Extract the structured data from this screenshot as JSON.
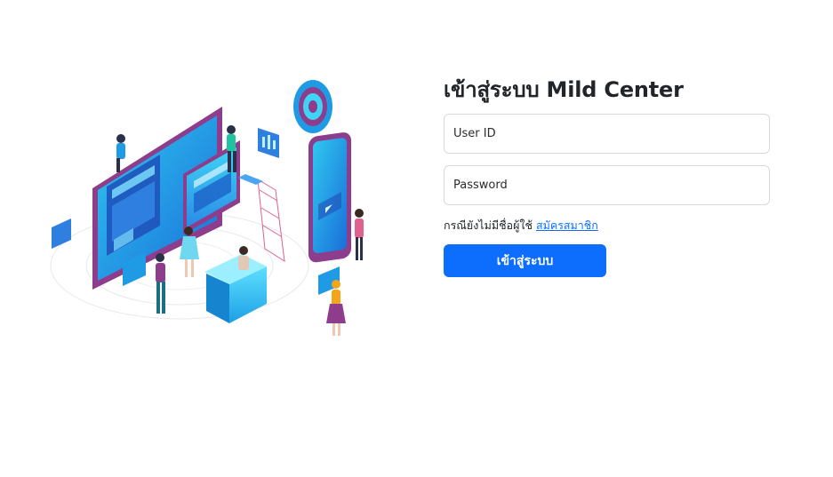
{
  "login": {
    "title": "เข้าสู่ระบบ Mild Center",
    "user_id_placeholder": "User ID",
    "user_id_value": "",
    "password_placeholder": "Password",
    "password_value": "",
    "no_account_text": "กรณียังไม่มีชื่อผู้ใช้",
    "register_link": "สมัครสมาชิก",
    "submit_label": "เข้าสู่ระบบ"
  },
  "colors": {
    "accent": "#0d6efd",
    "title_text": "#212529",
    "input_border": "#d7d9dd"
  },
  "illustration": {
    "icon": "isometric-digital-workspace-illustration"
  }
}
